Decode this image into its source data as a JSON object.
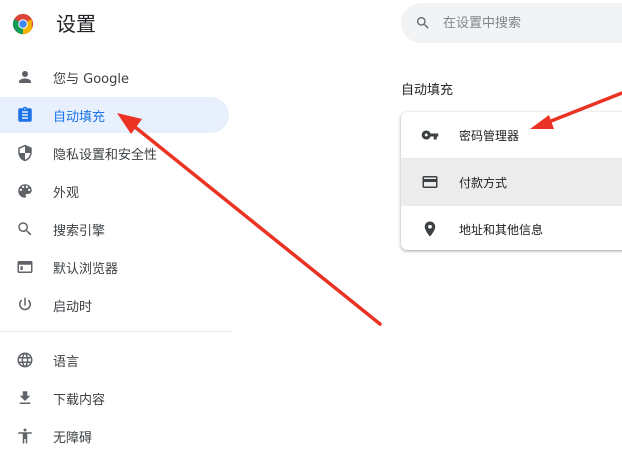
{
  "header": {
    "title": "设置",
    "logo_icon": "chrome-logo-icon"
  },
  "search": {
    "placeholder": "在设置中搜索",
    "value": ""
  },
  "sidebar": {
    "items": [
      {
        "label": "您与 Google",
        "icon": "person-icon"
      },
      {
        "label": "自动填充",
        "icon": "clipboard-icon",
        "active": true
      },
      {
        "label": "隐私设置和安全性",
        "icon": "shield-icon"
      },
      {
        "label": "外观",
        "icon": "palette-icon"
      },
      {
        "label": "搜索引擎",
        "icon": "search-icon"
      },
      {
        "label": "默认浏览器",
        "icon": "browser-window-icon"
      },
      {
        "label": "启动时",
        "icon": "power-icon"
      },
      {
        "label": "语言",
        "icon": "globe-icon"
      },
      {
        "label": "下载内容",
        "icon": "download-icon"
      },
      {
        "label": "无障碍",
        "icon": "accessibility-icon"
      }
    ]
  },
  "main": {
    "section_title": "自动填充",
    "rows": [
      {
        "label": "密码管理器",
        "icon": "key-icon"
      },
      {
        "label": "付款方式",
        "icon": "credit-card-icon"
      },
      {
        "label": "地址和其他信息",
        "icon": "location-pin-icon"
      }
    ]
  },
  "colors": {
    "accent": "#1a73e8",
    "active_bg": "#e8f0fe",
    "icon_gray": "#5f6368",
    "arrow_red": "#ea3323"
  }
}
